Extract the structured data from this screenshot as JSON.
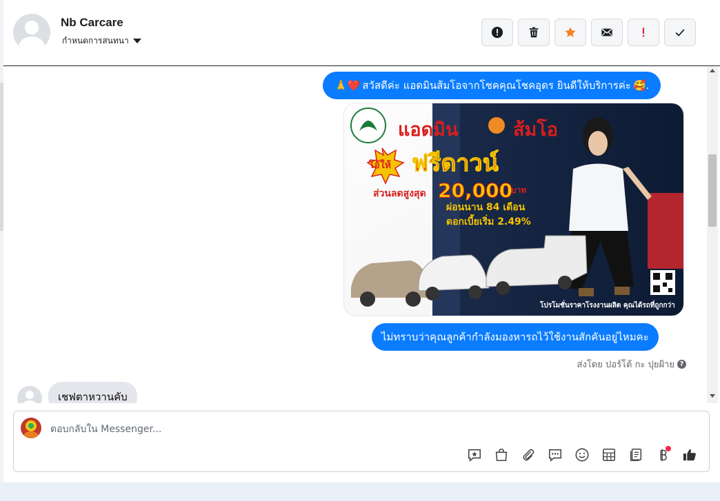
{
  "header": {
    "contact_name": "Nb Carcare",
    "assign_label": "กำหนดการสนทนา"
  },
  "actions": [
    {
      "icon": "alert-circle-icon",
      "name": "mark-spam-button"
    },
    {
      "icon": "trash-icon",
      "name": "delete-button"
    },
    {
      "icon": "star-icon",
      "name": "follow-up-button"
    },
    {
      "icon": "envelope-icon",
      "name": "mark-unread-button"
    },
    {
      "icon": "exclamation-icon",
      "name": "priority-button"
    },
    {
      "icon": "check-icon",
      "name": "mark-done-button"
    }
  ],
  "messages": {
    "greeting_pre": "🙏❤️",
    "greeting_text": "สวัสดีค่ะ แอดมินส้มโอจากโชคคุณโชคอุดร ยินดีให้บริการค่ะ",
    "greeting_post": "🥰.",
    "question": "ไม่ทราบว่าคุณลูกค้ากำลังมองหารถไว้ใช้งานสักคันอยู่ไหมคะ",
    "sent_by": "ส่งโดย ปอร์โต้ กะ ปุยฝ้าย",
    "customer_reply": "เชฟตาหวานคับ"
  },
  "promo_image": {
    "headline_1": "แอดมิน",
    "headline_2": "ส้มโอ",
    "give_label": "โอ้ให้",
    "free_down": "ฟรีดาวน์",
    "discount_label": "ส่วนลดสูงสุด",
    "discount_value": "20,000",
    "discount_unit": "บาท",
    "installment": "ผ่อนนาน 84 เดือน",
    "interest": "ดอกเบี้ยเริ่ม 2.49%",
    "footer": "โปรโมชั่นราคาโรงงานผลิต คุณได้รถที่ถูกกว่า"
  },
  "composer": {
    "placeholder": "ตอบกลับใน Messenger..."
  },
  "colors": {
    "accent": "#0a7cff",
    "star": "#f5821f",
    "priority": "#e41e3f",
    "notification": "#f02849"
  }
}
